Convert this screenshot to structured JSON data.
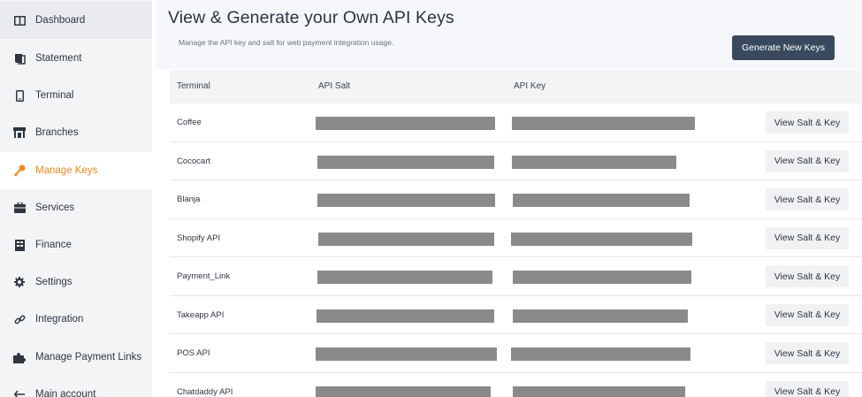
{
  "sidebar": {
    "items": [
      {
        "label": "Dashboard",
        "icon": "dashboard-icon"
      },
      {
        "label": "Statement",
        "icon": "statement-icon"
      },
      {
        "label": "Terminal",
        "icon": "terminal-icon"
      },
      {
        "label": "Branches",
        "icon": "branches-icon"
      },
      {
        "label": "Manage Keys",
        "icon": "key-icon"
      },
      {
        "label": "Services",
        "icon": "services-icon"
      },
      {
        "label": "Finance",
        "icon": "finance-icon"
      },
      {
        "label": "Settings",
        "icon": "gear-icon"
      },
      {
        "label": "Integration",
        "icon": "link-icon"
      },
      {
        "label": "Manage Payment Links",
        "icon": "puzzle-icon"
      },
      {
        "label": "Main account",
        "icon": "arrow-left-icon"
      }
    ],
    "active": "Manage Keys",
    "accent_color": "#f08a24"
  },
  "header": {
    "title": "View & Generate your Own API Keys",
    "subtitle": "Manage the API key and salt for web payment integration usage.",
    "generate_button": "Generate New Keys"
  },
  "table": {
    "columns": [
      "Terminal",
      "API Salt",
      "API Key",
      ""
    ],
    "rows": [
      {
        "terminal": "Coffee",
        "action": "View Salt & Key"
      },
      {
        "terminal": "Cococart",
        "action": "View Salt & Key"
      },
      {
        "terminal": "Blanja",
        "action": "View Salt & Key"
      },
      {
        "terminal": "Shopify API",
        "action": "View Salt & Key"
      },
      {
        "terminal": "Payment_Link",
        "action": "View Salt & Key"
      },
      {
        "terminal": "Takeapp API",
        "action": "View Salt & Key"
      },
      {
        "terminal": "POS API",
        "action": "View Salt & Key"
      },
      {
        "terminal": "Chatdaddy API",
        "action": "View Salt & Key"
      }
    ],
    "masked_value_color": "#8a8a8a"
  }
}
